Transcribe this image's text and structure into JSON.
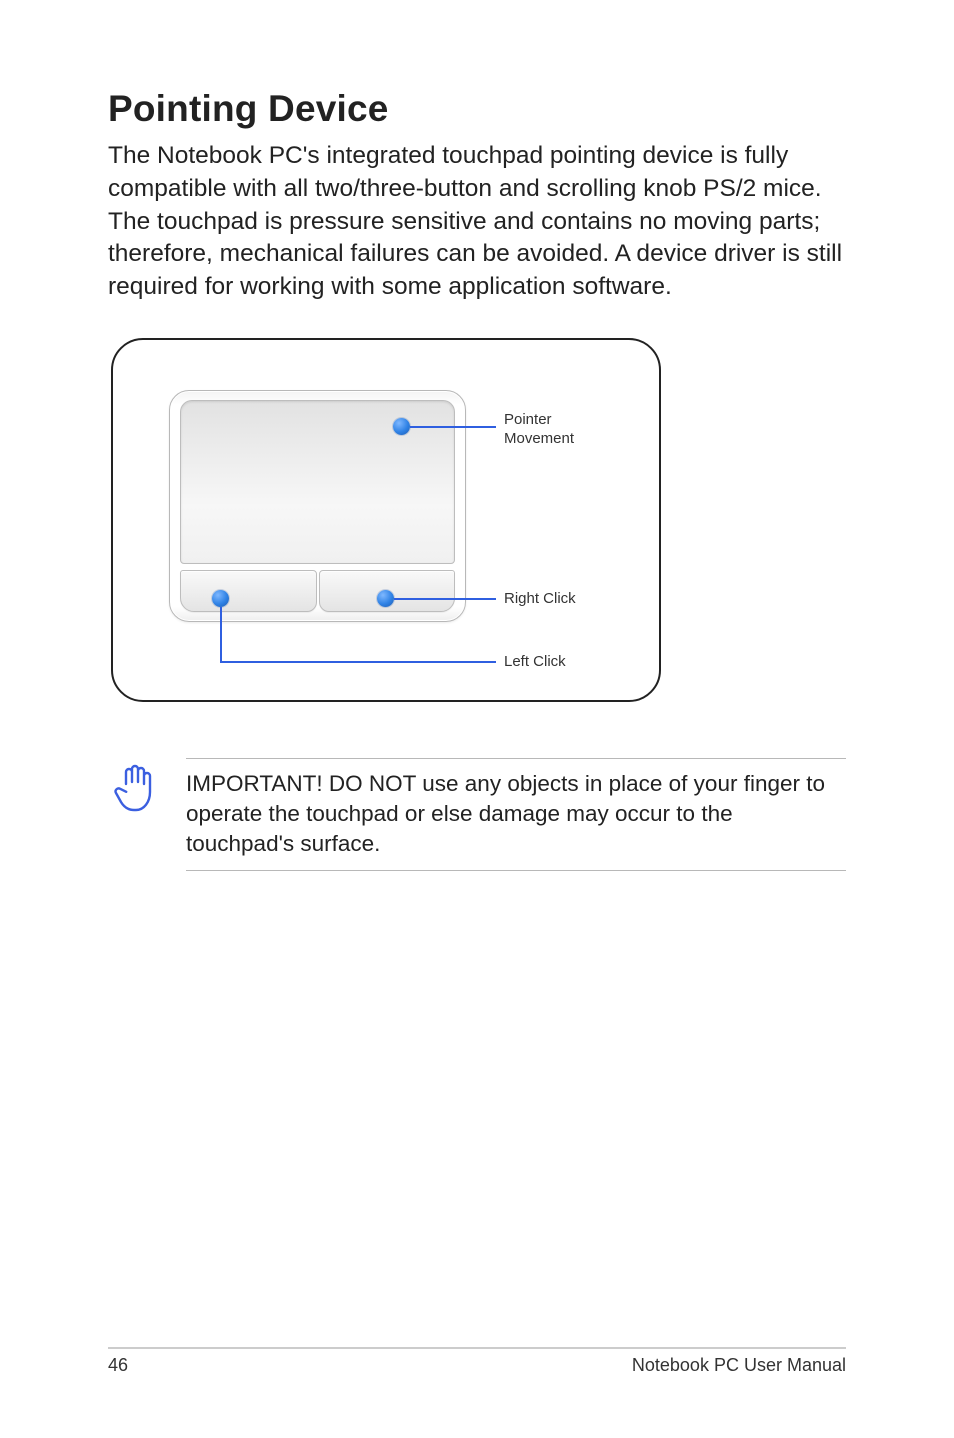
{
  "title": "Pointing Device",
  "intro": "The Notebook PC's integrated touchpad pointing device is fully compatible with all two/three-button and scrolling knob PS/2 mice. The touchpad is pressure sensitive and contains no moving parts; therefore, mechanical failures can be avoided. A device driver is still required for working with some application software.",
  "diagram": {
    "labels": {
      "pointer1": "Pointer",
      "pointer2": "Movement",
      "right_click": "Right Click",
      "left_click": "Left Click"
    }
  },
  "note": "IMPORTANT! DO NOT use any objects in place of your finger to operate the touchpad or else damage may occur to the touchpad's surface.",
  "footer": {
    "page": "46",
    "doc": "Notebook PC User Manual"
  }
}
